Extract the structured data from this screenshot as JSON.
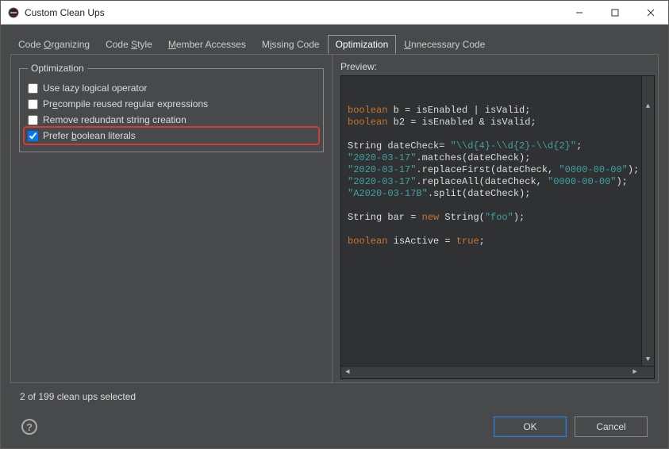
{
  "window": {
    "title": "Custom Clean Ups"
  },
  "tabs": [
    {
      "label": "Code Organizing",
      "mnemonic_index": 5
    },
    {
      "label": "Code Style",
      "mnemonic_index": 5
    },
    {
      "label": "Member Accesses",
      "mnemonic_index": 0
    },
    {
      "label": "Missing Code",
      "mnemonic_index": 1
    },
    {
      "label": "Optimization",
      "mnemonic_index": -1,
      "active": true
    },
    {
      "label": "Unnecessary Code",
      "mnemonic_index": 0
    }
  ],
  "optimization": {
    "legend": "Optimization",
    "options": [
      {
        "label": "Use lazy logical operator",
        "checked": false,
        "mnemonic_index": -1
      },
      {
        "label": "Precompile reused regular expressions",
        "checked": false,
        "mnemonic_index": 2
      },
      {
        "label": "Remove redundant string creation",
        "checked": false,
        "mnemonic_index": -1
      },
      {
        "label": "Prefer boolean literals",
        "checked": true,
        "mnemonic_index": 7,
        "highlight": true
      }
    ]
  },
  "preview": {
    "label": "Preview:",
    "code_tokens": [
      [
        {
          "t": "boolean",
          "c": "kw"
        },
        {
          "t": " b = isEnabled | isValid;"
        }
      ],
      [
        {
          "t": "boolean",
          "c": "kw"
        },
        {
          "t": " b2 = isEnabled & isValid;"
        }
      ],
      [],
      [
        {
          "t": "String dateCheck= "
        },
        {
          "t": "\"\\\\d{4}-\\\\d{2}-\\\\d{2}\"",
          "c": "str"
        },
        {
          "t": ";"
        }
      ],
      [
        {
          "t": "\"2020-03-17\"",
          "c": "str"
        },
        {
          "t": ".matches(dateCheck);"
        }
      ],
      [
        {
          "t": "\"2020-03-17\"",
          "c": "str"
        },
        {
          "t": ".replaceFirst(dateCheck, "
        },
        {
          "t": "\"0000-00-00\"",
          "c": "str"
        },
        {
          "t": ");"
        }
      ],
      [
        {
          "t": "\"2020-03-17\"",
          "c": "str"
        },
        {
          "t": ".replaceAll(dateCheck, "
        },
        {
          "t": "\"0000-00-00\"",
          "c": "str"
        },
        {
          "t": ");"
        }
      ],
      [
        {
          "t": "\"A2020-03-17B\"",
          "c": "str"
        },
        {
          "t": ".split(dateCheck);"
        }
      ],
      [],
      [
        {
          "t": "String bar = "
        },
        {
          "t": "new",
          "c": "kw"
        },
        {
          "t": " String("
        },
        {
          "t": "\"foo\"",
          "c": "str"
        },
        {
          "t": ");"
        }
      ],
      [],
      [
        {
          "t": "boolean",
          "c": "kw"
        },
        {
          "t": " isActive = "
        },
        {
          "t": "true",
          "c": "kw"
        },
        {
          "t": ";"
        }
      ]
    ]
  },
  "status": "2 of 199 clean ups selected",
  "buttons": {
    "ok": "OK",
    "cancel": "Cancel"
  }
}
